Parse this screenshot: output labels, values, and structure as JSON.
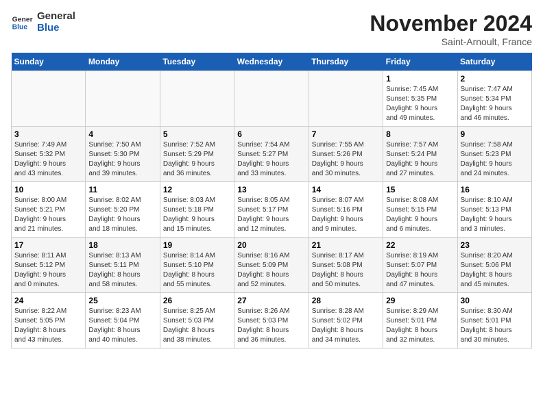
{
  "logo": {
    "text_general": "General",
    "text_blue": "Blue"
  },
  "title": "November 2024",
  "subtitle": "Saint-Arnoult, France",
  "weekdays": [
    "Sunday",
    "Monday",
    "Tuesday",
    "Wednesday",
    "Thursday",
    "Friday",
    "Saturday"
  ],
  "weeks": [
    [
      {
        "day": "",
        "info": ""
      },
      {
        "day": "",
        "info": ""
      },
      {
        "day": "",
        "info": ""
      },
      {
        "day": "",
        "info": ""
      },
      {
        "day": "",
        "info": ""
      },
      {
        "day": "1",
        "info": "Sunrise: 7:45 AM\nSunset: 5:35 PM\nDaylight: 9 hours\nand 49 minutes."
      },
      {
        "day": "2",
        "info": "Sunrise: 7:47 AM\nSunset: 5:34 PM\nDaylight: 9 hours\nand 46 minutes."
      }
    ],
    [
      {
        "day": "3",
        "info": "Sunrise: 7:49 AM\nSunset: 5:32 PM\nDaylight: 9 hours\nand 43 minutes."
      },
      {
        "day": "4",
        "info": "Sunrise: 7:50 AM\nSunset: 5:30 PM\nDaylight: 9 hours\nand 39 minutes."
      },
      {
        "day": "5",
        "info": "Sunrise: 7:52 AM\nSunset: 5:29 PM\nDaylight: 9 hours\nand 36 minutes."
      },
      {
        "day": "6",
        "info": "Sunrise: 7:54 AM\nSunset: 5:27 PM\nDaylight: 9 hours\nand 33 minutes."
      },
      {
        "day": "7",
        "info": "Sunrise: 7:55 AM\nSunset: 5:26 PM\nDaylight: 9 hours\nand 30 minutes."
      },
      {
        "day": "8",
        "info": "Sunrise: 7:57 AM\nSunset: 5:24 PM\nDaylight: 9 hours\nand 27 minutes."
      },
      {
        "day": "9",
        "info": "Sunrise: 7:58 AM\nSunset: 5:23 PM\nDaylight: 9 hours\nand 24 minutes."
      }
    ],
    [
      {
        "day": "10",
        "info": "Sunrise: 8:00 AM\nSunset: 5:21 PM\nDaylight: 9 hours\nand 21 minutes."
      },
      {
        "day": "11",
        "info": "Sunrise: 8:02 AM\nSunset: 5:20 PM\nDaylight: 9 hours\nand 18 minutes."
      },
      {
        "day": "12",
        "info": "Sunrise: 8:03 AM\nSunset: 5:18 PM\nDaylight: 9 hours\nand 15 minutes."
      },
      {
        "day": "13",
        "info": "Sunrise: 8:05 AM\nSunset: 5:17 PM\nDaylight: 9 hours\nand 12 minutes."
      },
      {
        "day": "14",
        "info": "Sunrise: 8:07 AM\nSunset: 5:16 PM\nDaylight: 9 hours\nand 9 minutes."
      },
      {
        "day": "15",
        "info": "Sunrise: 8:08 AM\nSunset: 5:15 PM\nDaylight: 9 hours\nand 6 minutes."
      },
      {
        "day": "16",
        "info": "Sunrise: 8:10 AM\nSunset: 5:13 PM\nDaylight: 9 hours\nand 3 minutes."
      }
    ],
    [
      {
        "day": "17",
        "info": "Sunrise: 8:11 AM\nSunset: 5:12 PM\nDaylight: 9 hours\nand 0 minutes."
      },
      {
        "day": "18",
        "info": "Sunrise: 8:13 AM\nSunset: 5:11 PM\nDaylight: 8 hours\nand 58 minutes."
      },
      {
        "day": "19",
        "info": "Sunrise: 8:14 AM\nSunset: 5:10 PM\nDaylight: 8 hours\nand 55 minutes."
      },
      {
        "day": "20",
        "info": "Sunrise: 8:16 AM\nSunset: 5:09 PM\nDaylight: 8 hours\nand 52 minutes."
      },
      {
        "day": "21",
        "info": "Sunrise: 8:17 AM\nSunset: 5:08 PM\nDaylight: 8 hours\nand 50 minutes."
      },
      {
        "day": "22",
        "info": "Sunrise: 8:19 AM\nSunset: 5:07 PM\nDaylight: 8 hours\nand 47 minutes."
      },
      {
        "day": "23",
        "info": "Sunrise: 8:20 AM\nSunset: 5:06 PM\nDaylight: 8 hours\nand 45 minutes."
      }
    ],
    [
      {
        "day": "24",
        "info": "Sunrise: 8:22 AM\nSunset: 5:05 PM\nDaylight: 8 hours\nand 43 minutes."
      },
      {
        "day": "25",
        "info": "Sunrise: 8:23 AM\nSunset: 5:04 PM\nDaylight: 8 hours\nand 40 minutes."
      },
      {
        "day": "26",
        "info": "Sunrise: 8:25 AM\nSunset: 5:03 PM\nDaylight: 8 hours\nand 38 minutes."
      },
      {
        "day": "27",
        "info": "Sunrise: 8:26 AM\nSunset: 5:03 PM\nDaylight: 8 hours\nand 36 minutes."
      },
      {
        "day": "28",
        "info": "Sunrise: 8:28 AM\nSunset: 5:02 PM\nDaylight: 8 hours\nand 34 minutes."
      },
      {
        "day": "29",
        "info": "Sunrise: 8:29 AM\nSunset: 5:01 PM\nDaylight: 8 hours\nand 32 minutes."
      },
      {
        "day": "30",
        "info": "Sunrise: 8:30 AM\nSunset: 5:01 PM\nDaylight: 8 hours\nand 30 minutes."
      }
    ]
  ]
}
